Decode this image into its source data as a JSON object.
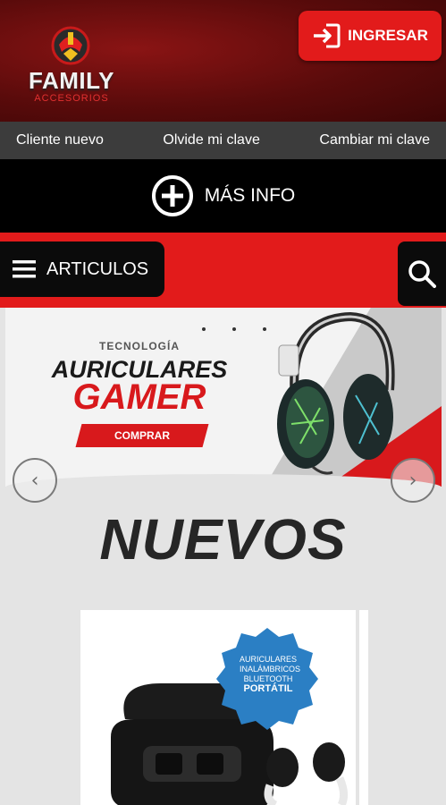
{
  "brand": {
    "name": "FAMILY",
    "sub": "ACCESORIOS"
  },
  "header": {
    "login_label": "INGRESAR"
  },
  "subnav": {
    "items": [
      {
        "label": "Cliente nuevo"
      },
      {
        "label": "Olvide mi clave"
      },
      {
        "label": "Cambiar mi clave"
      }
    ]
  },
  "info": {
    "label": "MÁS INFO"
  },
  "menu": {
    "label": "ARTICULOS"
  },
  "banner": {
    "kicker": "TECNOLOGÍA",
    "title": "AURICULARES",
    "title2": "GAMER",
    "cta": "COMPRAR"
  },
  "section": {
    "title": "NUEVOS"
  },
  "product": {
    "badge_line1": "AURICULARES",
    "badge_line2": "INALÁMBRICOS",
    "badge_line3": "BLUETOOTH",
    "badge_line4": "PORTÁTIL"
  },
  "colors": {
    "brand_red": "#e21b1b",
    "header_dark_red": "#5a0b0b",
    "nav_gray": "#3c3c3c",
    "badge_blue": "#2b7fc4"
  },
  "icons": {
    "login": "login-arrow-icon",
    "info": "plus-circle-icon",
    "menu": "hamburger-icon",
    "search": "search-icon",
    "prev": "chevron-left-icon",
    "next": "chevron-right-icon"
  }
}
